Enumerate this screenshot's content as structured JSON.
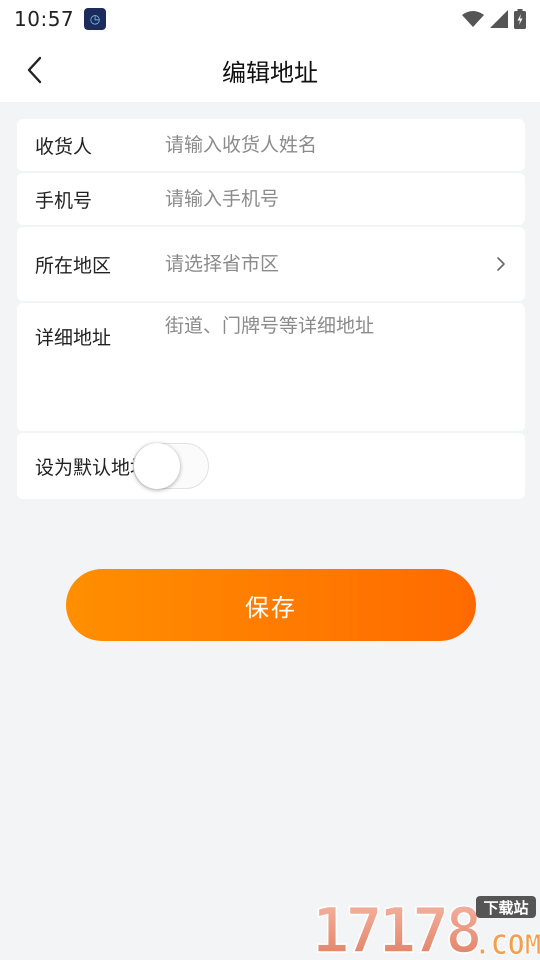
{
  "status_bar": {
    "time": "10:57"
  },
  "nav": {
    "title": "编辑地址"
  },
  "form": {
    "receiver": {
      "label": "收货人",
      "placeholder": "请输入收货人姓名",
      "value": ""
    },
    "phone": {
      "label": "手机号",
      "placeholder": "请输入手机号",
      "value": ""
    },
    "region": {
      "label": "所在地区",
      "placeholder": "请选择省市区",
      "value": ""
    },
    "detail": {
      "label": "详细地址",
      "placeholder": "街道、门牌号等详细地址",
      "value": ""
    },
    "default": {
      "label": "设为默认地址",
      "enabled": false
    }
  },
  "actions": {
    "save_label": "保存"
  },
  "watermark": {
    "number": "17178",
    "tag": "下载站",
    "domain": ".COM"
  },
  "colors": {
    "accent_start": "#ff8f00",
    "accent_end": "#ff6a00",
    "background": "#f3f4f6"
  }
}
